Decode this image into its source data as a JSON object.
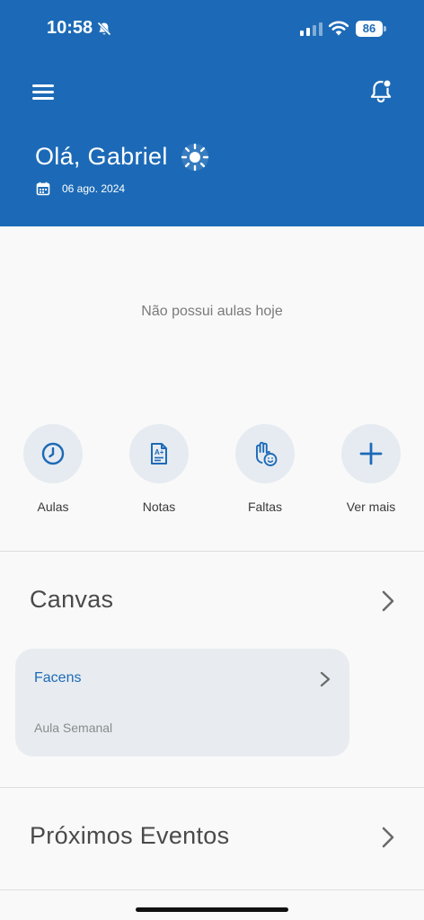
{
  "status_bar": {
    "time": "10:58",
    "battery": "86"
  },
  "header": {
    "greeting": "Olá, Gabriel",
    "date": "06 ago. 2024",
    "color": "#1c6ab7"
  },
  "schedule": {
    "empty_message": "Não possui aulas hoje"
  },
  "quick_actions": [
    {
      "label": "Aulas",
      "icon": "clock-icon"
    },
    {
      "label": "Notas",
      "icon": "grade-document-icon"
    },
    {
      "label": "Faltas",
      "icon": "hand-smile-icon"
    },
    {
      "label": "Ver mais",
      "icon": "plus-icon"
    }
  ],
  "canvas": {
    "title": "Canvas",
    "card": {
      "title": "Facens",
      "subtitle": "Aula Semanal"
    }
  },
  "events": {
    "title": "Próximos Eventos"
  }
}
